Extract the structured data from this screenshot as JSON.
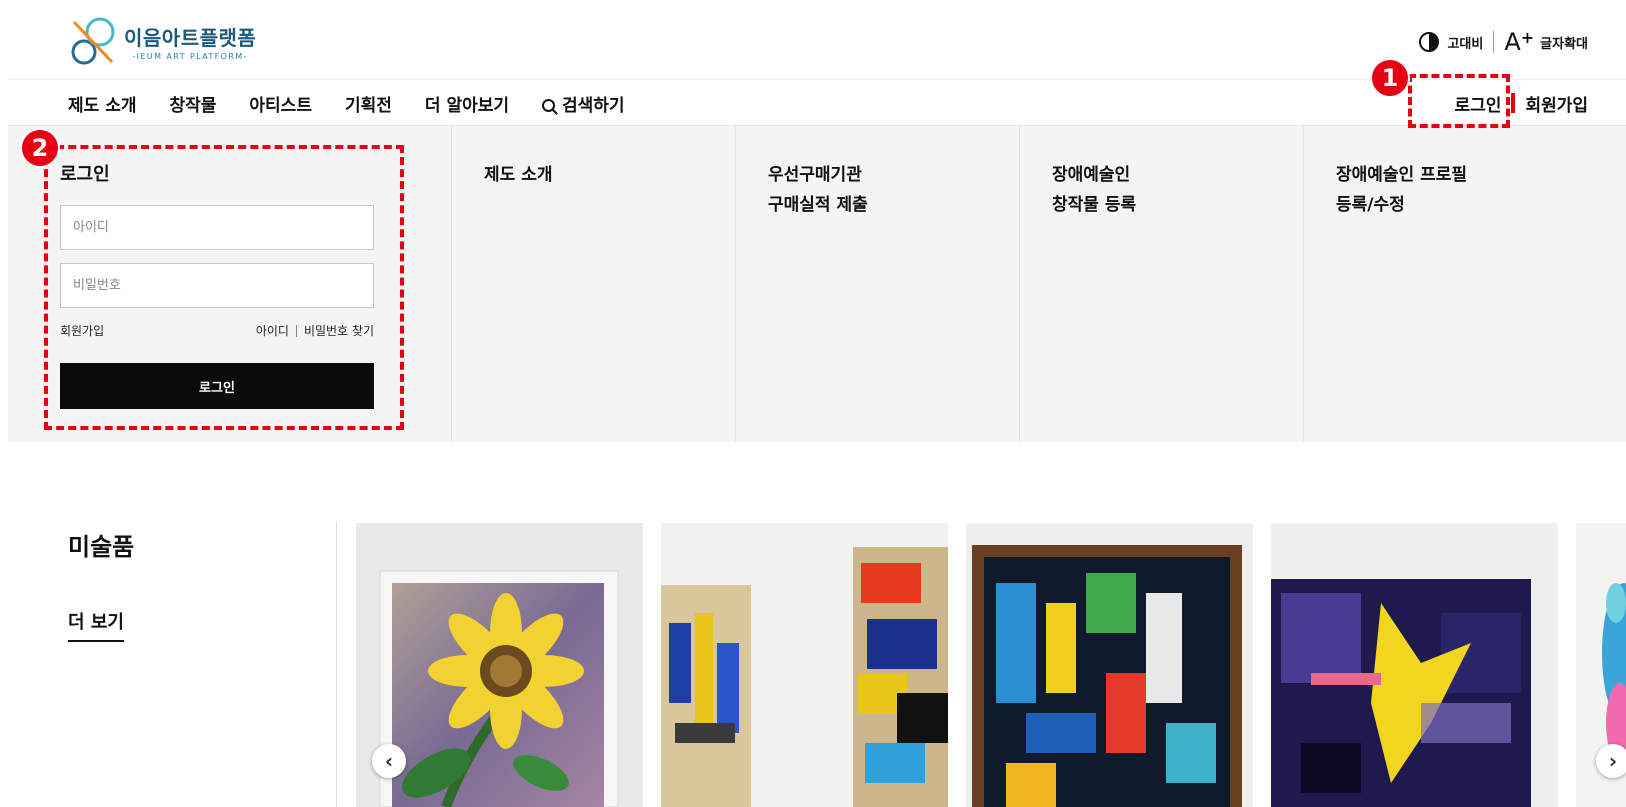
{
  "header": {
    "logo_title": "이음아트플랫폼",
    "logo_sub": "-IEUM ART PLATFORM-",
    "contrast_label": "고대비",
    "zoom_mark": "A",
    "zoom_plus": "+",
    "zoom_label": "글자확대"
  },
  "nav": {
    "items": [
      "제도 소개",
      "창작물",
      "아티스트",
      "기획전",
      "더 알아보기",
      "검색하기"
    ],
    "login": "로그인",
    "signup": "회원가입"
  },
  "annotations": {
    "badge1": "1",
    "badge2": "2"
  },
  "login_panel": {
    "title": "로그인",
    "id_placeholder": "아이디",
    "pw_placeholder": "비밀번호",
    "signup_link": "회원가입",
    "find_id": "아이디",
    "find_pw": "비밀번호 찾기",
    "submit": "로그인"
  },
  "mega_menu": [
    "제도 소개",
    "우선구매기관\n구매실적 제출",
    "장애예술인\n창작물 등록",
    "장애예술인 프로필\n등록/수정"
  ],
  "gallery": {
    "title": "미술품",
    "more": "더 보기",
    "prev": "‹",
    "next": "›"
  },
  "colors": {
    "accent_red": "#e60012",
    "logo_teal": "#1d5a79",
    "logo_orange": "#f08a1c"
  }
}
